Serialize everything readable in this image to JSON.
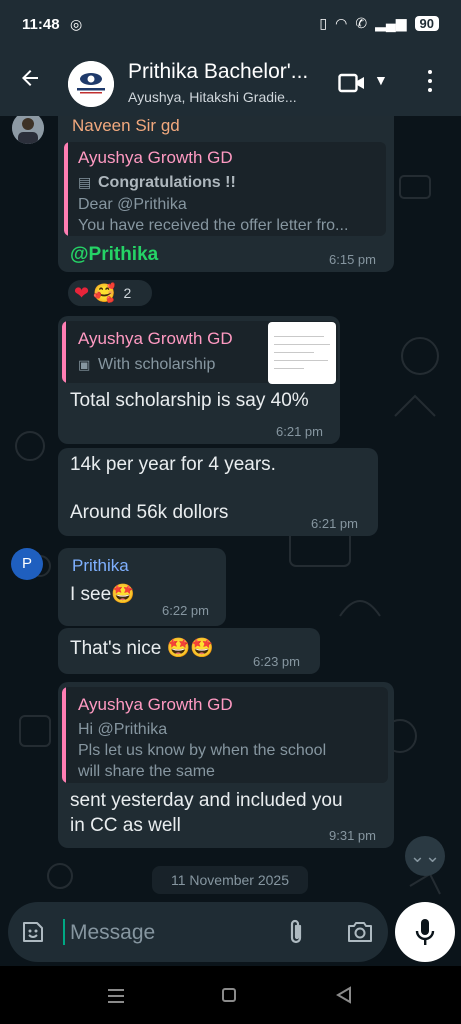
{
  "status": {
    "time": "11:48",
    "battery": "90"
  },
  "header": {
    "title": "Prithika Bachelor'...",
    "subtitle": "Ayushya, Hitakshi Gradie..."
  },
  "messages": {
    "m1": {
      "sender": "Naveen Sir gd",
      "quote_name": "Ayushya Growth GD",
      "quote_title": "Congratulations !!",
      "quote_line1": "Dear @Prithika",
      "quote_line2": "You have received the offer letter fro...",
      "text": "@Prithika",
      "time": "6:15 pm",
      "reaction_count": "2"
    },
    "m2": {
      "quote_name": "Ayushya Growth GD",
      "quote_text": "With scholarship",
      "text": "Total scholarship is say 40%",
      "time": "6:21 pm"
    },
    "m3": {
      "line1": "14k per year for 4 years.",
      "line2": "Around 56k dollors",
      "time": "6:21 pm"
    },
    "m4": {
      "avatar_letter": "P",
      "sender": "Prithika",
      "text": "I see",
      "time": "6:22 pm"
    },
    "m5": {
      "text": "That's nice",
      "time": "6:23 pm"
    },
    "m6": {
      "quote_name": "Ayushya Growth GD",
      "quote_line1": "Hi @Prithika",
      "quote_line2": "Pls let us know by when the school",
      "quote_line3": "will share the same",
      "line1": "sent yesterday and included you",
      "line2": "in CC as well",
      "time": "9:31 pm"
    }
  },
  "date_chip": "11 November 2025",
  "composer": {
    "placeholder": "Message"
  },
  "colors": {
    "accent": "#00a884",
    "mention": "#25d366",
    "quote_name": "#ff9ac2",
    "bubble": "#202c33",
    "background": "#0b141a"
  }
}
